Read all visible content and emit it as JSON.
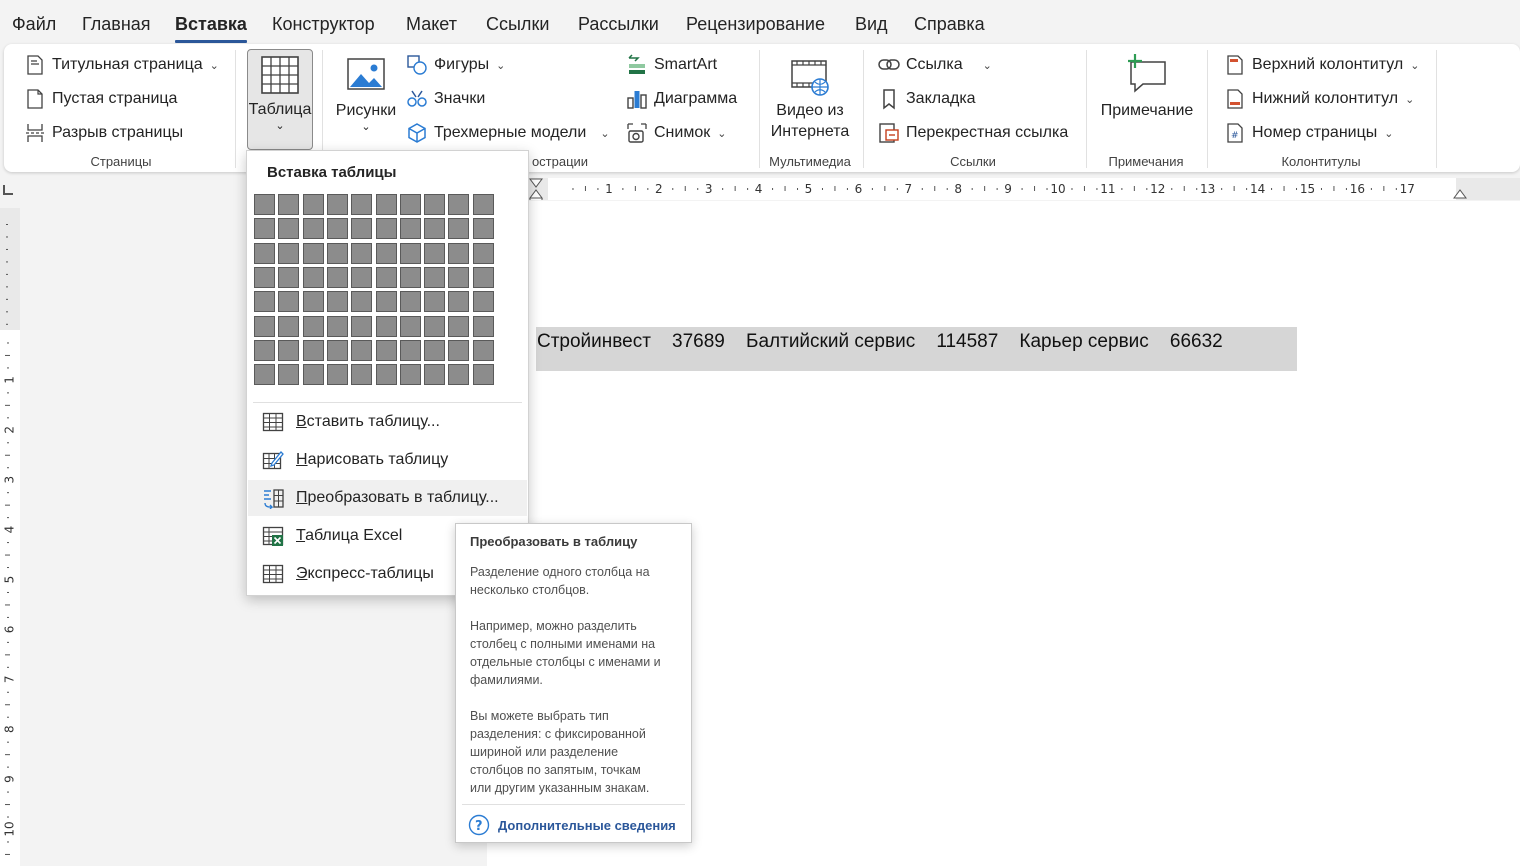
{
  "tabs": [
    "Файл",
    "Главная",
    "Вставка",
    "Конструктор",
    "Макет",
    "Ссылки",
    "Рассылки",
    "Рецензирование",
    "Вид",
    "Справка"
  ],
  "active_tab": "Вставка",
  "ribbon": {
    "pages": {
      "cover_page": "Титульная страница",
      "blank_page": "Пустая страница",
      "page_break": "Разрыв страницы",
      "group_label": "Страницы"
    },
    "table_button": "Таблица",
    "pictures_button": "Рисунки",
    "illustrations": {
      "shapes": "Фигуры",
      "icons": "Значки",
      "models_3d": "Трехмерные модели",
      "smartart": "SmartArt",
      "chart": "Диаграмма",
      "screenshot": "Снимок",
      "group_label_partial": "острации"
    },
    "media": {
      "online_video": "Видео из Интернета",
      "group_label": "Мультимедиа"
    },
    "links": {
      "link": "Ссылка",
      "bookmark": "Закладка",
      "cross_ref": "Перекрестная ссылка",
      "group_label": "Ссылки"
    },
    "comments": {
      "comment": "Примечание",
      "group_label": "Примечания"
    },
    "header_footer": {
      "header": "Верхний колонтитул",
      "footer": "Нижний колонтитул",
      "page_number": "Номер страницы",
      "group_label": "Колонтитулы"
    }
  },
  "ruler_numbers": [
    "1",
    "2",
    "3",
    "4",
    "5",
    "6",
    "7",
    "8",
    "9",
    "10",
    "11",
    "12",
    "13",
    "14",
    "15",
    "16",
    "17"
  ],
  "vruler_numbers": [
    "1",
    "2",
    "3",
    "4",
    "5",
    "6",
    "7",
    "8",
    "9",
    "10"
  ],
  "document": {
    "line": "Стройинвест    37689    Балтийский сервис    114587    Карьер сервис    66632"
  },
  "dropdown": {
    "title": "Вставка таблицы",
    "grid_cols": 10,
    "grid_rows": 8,
    "items": [
      {
        "label": "Вставить таблицу..."
      },
      {
        "label": "Нарисовать таблицу"
      },
      {
        "label": "Преобразовать в таблицу..."
      },
      {
        "label": "Таблица Excel"
      },
      {
        "label": "Экспресс-таблицы"
      }
    ]
  },
  "tooltip": {
    "title": "Преобразовать в таблицу",
    "p1": "Разделение одного столбца на\nнесколько столбцов.",
    "p2": "Например, можно разделить\nстолбец с полными именами на\nотдельные столбцы с именами и\nфамилиями.",
    "p3": "Вы можете выбрать тип\nразделения: с фиксированной\nшириной или разделение\nстолбцов по запятым, точкам\nили другим указанным знакам.",
    "link": "Дополнительные сведения"
  },
  "colors": {
    "accent": "#2b579a",
    "selection": "#d6d6d6",
    "grid_cell": "#8c8c8c"
  }
}
